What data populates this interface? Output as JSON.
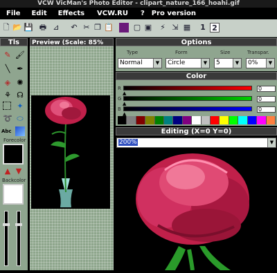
{
  "title": "VCW VicMan's Photo Editor - clipart_nature_166_hoahi.gif",
  "menu": [
    "File",
    "Edit",
    "Effects",
    "VCW.RU",
    "?",
    "Pro version"
  ],
  "toolbar": {
    "tab1": "1",
    "tab2": "2"
  },
  "tools": {
    "header": "Tls",
    "forecolor_label": "Forecolor",
    "backcolor_label": "Backcolor",
    "text_tool": "Abc"
  },
  "preview": {
    "header": "Preview (Scale: 85%"
  },
  "options": {
    "header": "Options",
    "type_label": "Type",
    "form_label": "Form",
    "size_label": "Size",
    "transp_label": "Transpar.",
    "type_value": "Normal",
    "form_value": "Circle",
    "size_value": "5",
    "transp_value": "0%"
  },
  "color": {
    "header": "Color",
    "r_label": "R",
    "g_label": "G",
    "b_label": "B",
    "r_value": "0",
    "g_value": "0",
    "b_value": "0",
    "palette": [
      "#000000",
      "#808080",
      "#800000",
      "#808000",
      "#008000",
      "#008080",
      "#000080",
      "#800080",
      "#ffffff",
      "#c0c0c0",
      "#ff0000",
      "#ffff00",
      "#00ff00",
      "#00ffff",
      "#0000ff",
      "#ff00ff",
      "#ff8040"
    ]
  },
  "editing": {
    "header": "Editing (X=0 Y=0)",
    "zoom_value": "200%"
  }
}
